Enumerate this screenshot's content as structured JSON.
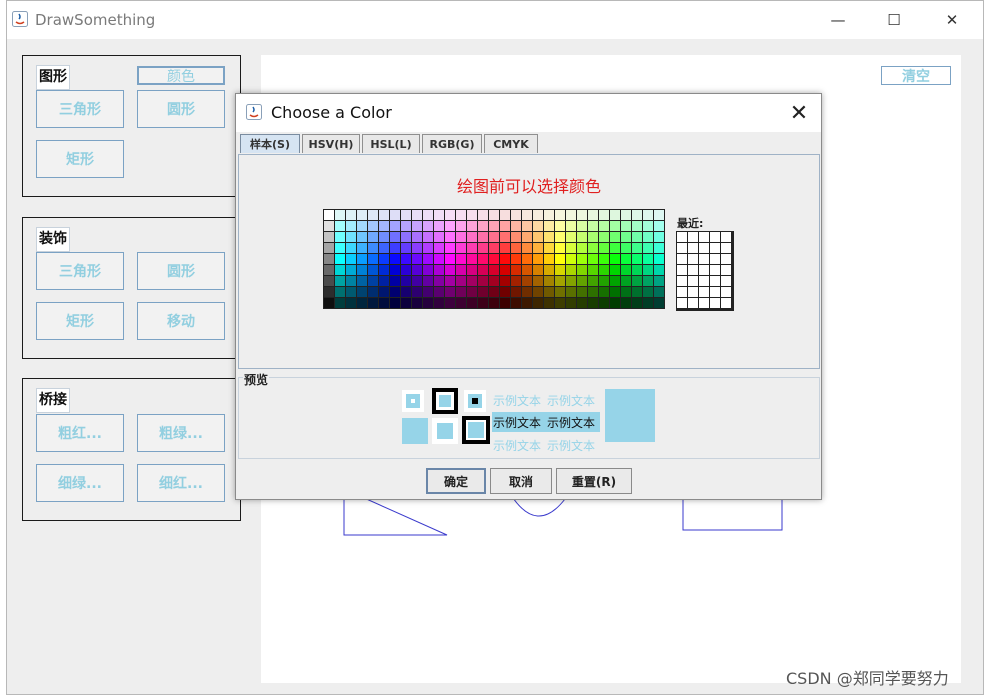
{
  "app": {
    "title": "DrawSomething",
    "minimize": "—",
    "maximize": "☐",
    "close": "✕"
  },
  "panels": {
    "shapes": {
      "title": "图形",
      "color_button": "颜色",
      "buttons": [
        "三角形",
        "圆形",
        "矩形"
      ]
    },
    "decor": {
      "title": "装饰",
      "buttons": [
        "三角形",
        "圆形",
        "矩形",
        "移动"
      ]
    },
    "bridge": {
      "title": "桥接",
      "buttons": [
        "粗红...",
        "粗绿...",
        "细绿...",
        "细红..."
      ]
    }
  },
  "canvas": {
    "clear_button": "清空"
  },
  "dialog": {
    "title": "Choose a Color",
    "close": "✕",
    "tabs": [
      "样本(S)",
      "HSV(H)",
      "HSL(L)",
      "RGB(G)",
      "CMYK"
    ],
    "active_tab": "样本(S)",
    "hint": "绘图前可以选择颜色",
    "recent_label": "最近:",
    "preview_label": "预览",
    "sample_text": "示例文本",
    "preview_color": "#96d4e8",
    "buttons": {
      "ok": "确定",
      "cancel": "取消",
      "reset": "重置(R)"
    }
  },
  "watermark": "CSDN @郑同学要努力",
  "colors": {
    "accent_text": "#92cfe0",
    "hint": "#e02020"
  }
}
